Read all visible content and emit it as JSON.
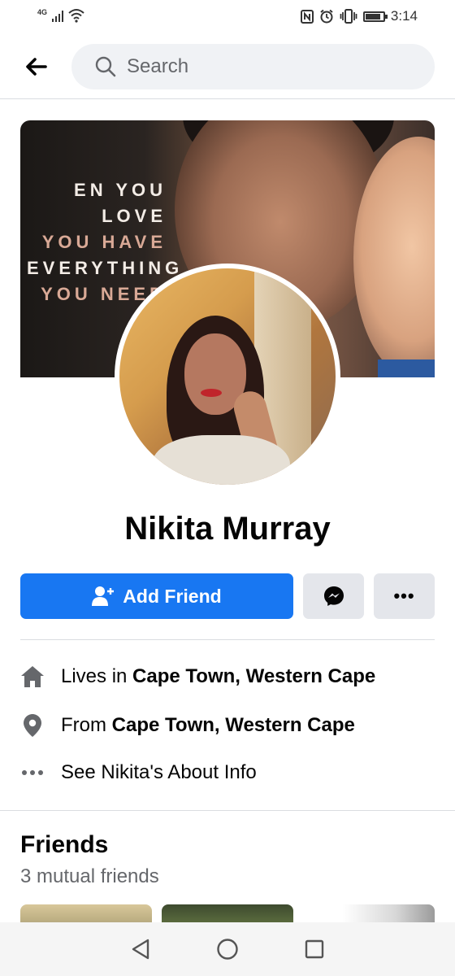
{
  "status_bar": {
    "network": "4G",
    "time": "3:14"
  },
  "search": {
    "placeholder": "Search"
  },
  "cover": {
    "quote_lines": [
      "EN YOU LOVE",
      "YOU HAVE",
      "EVERYTHING",
      "YOU NEED"
    ]
  },
  "profile": {
    "name": "Nikita Murray"
  },
  "actions": {
    "add_friend": "Add Friend",
    "more": "•••"
  },
  "info": {
    "lives_prefix": "Lives in ",
    "lives_place": "Cape Town, Western Cape",
    "from_prefix": "From ",
    "from_place": "Cape Town, Western Cape",
    "about": "See Nikita's About Info"
  },
  "friends": {
    "title": "Friends",
    "mutual": "3 mutual friends"
  },
  "colors": {
    "brand_blue": "#1877f2",
    "button_grey": "#e4e6eb",
    "secondary_text": "#65676b"
  },
  "icons": [
    "signal-icon",
    "wifi-icon",
    "nfc-icon",
    "alarm-icon",
    "vibrate-icon",
    "battery-icon",
    "back-arrow-icon",
    "search-icon",
    "add-friend-icon",
    "messenger-icon",
    "more-icon",
    "home-icon",
    "location-pin-icon",
    "ellipsis-icon",
    "nav-back-icon",
    "nav-home-icon",
    "nav-recents-icon"
  ]
}
